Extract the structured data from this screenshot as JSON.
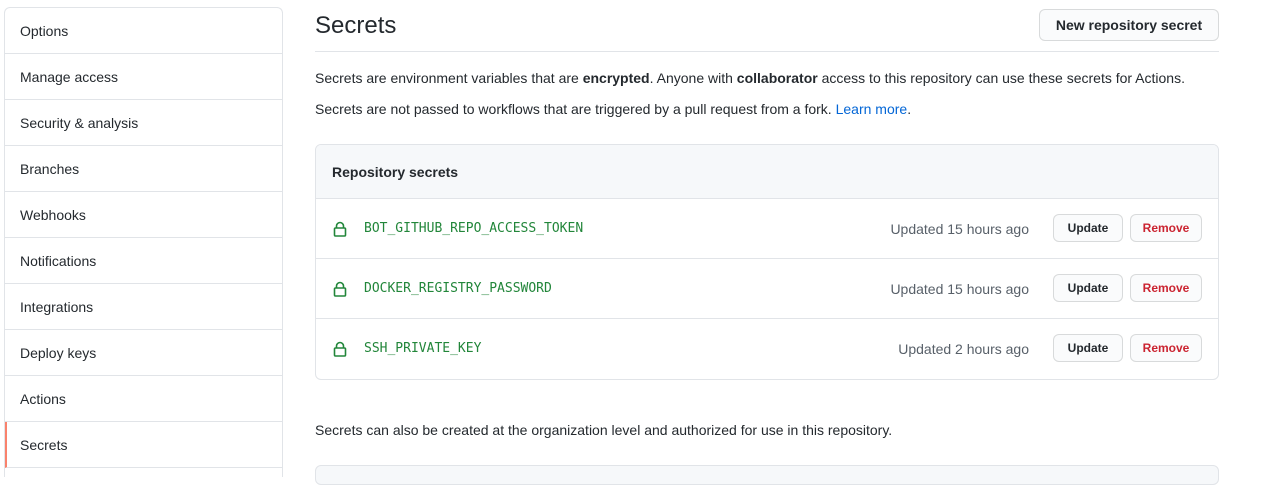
{
  "sidebar": {
    "items": [
      {
        "label": "Options"
      },
      {
        "label": "Manage access"
      },
      {
        "label": "Security & analysis"
      },
      {
        "label": "Branches"
      },
      {
        "label": "Webhooks"
      },
      {
        "label": "Notifications"
      },
      {
        "label": "Integrations"
      },
      {
        "label": "Deploy keys"
      },
      {
        "label": "Actions"
      },
      {
        "label": "Secrets"
      }
    ],
    "selected": "Secrets"
  },
  "header": {
    "title": "Secrets",
    "new_button": "New repository secret"
  },
  "description": {
    "line1_a": "Secrets are environment variables that are ",
    "line1_b": "encrypted",
    "line1_c": ". Anyone with ",
    "line1_d": "collaborator",
    "line1_e": " access to this repository can use these secrets for Actions.",
    "line2_a": "Secrets are not passed to workflows that are triggered by a pull request from a fork. ",
    "line2_link": "Learn more",
    "line2_end": "."
  },
  "repo_secrets": {
    "header": "Repository secrets",
    "items": [
      {
        "name": "BOT_GITHUB_REPO_ACCESS_TOKEN",
        "updated": "Updated 15 hours ago",
        "update_label": "Update",
        "remove_label": "Remove"
      },
      {
        "name": "DOCKER_REGISTRY_PASSWORD",
        "updated": "Updated 15 hours ago",
        "update_label": "Update",
        "remove_label": "Remove"
      },
      {
        "name": "SSH_PRIVATE_KEY",
        "updated": "Updated 2 hours ago",
        "update_label": "Update",
        "remove_label": "Remove"
      }
    ]
  },
  "org_note": "Secrets can also be created at the organization level and authorized for use in this repository.",
  "colors": {
    "accent_selected": "#f9826c",
    "link": "#0366d6",
    "secret_name": "#22863a",
    "danger": "#cb2431",
    "border": "#e1e4e8"
  },
  "icons": {
    "secret_row": "lock-icon"
  }
}
